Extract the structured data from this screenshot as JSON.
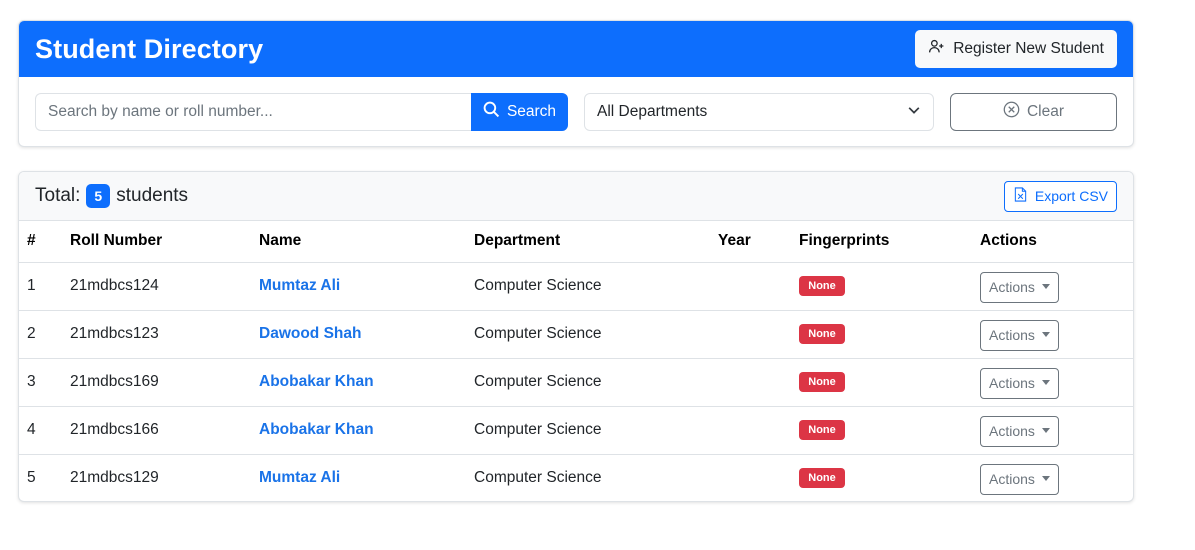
{
  "header": {
    "title": "Student Directory",
    "register_label": "Register New Student",
    "register_icon": "person-plus-icon"
  },
  "filters": {
    "search_placeholder": "Search by name or roll number...",
    "search_value": "",
    "search_label": "Search",
    "department_selected": "All Departments",
    "clear_label": "Clear"
  },
  "list": {
    "total_label": "Total:",
    "count": "5",
    "students_label": "students",
    "export_label": "Export CSV",
    "columns": [
      "#",
      "Roll Number",
      "Name",
      "Department",
      "Year",
      "Fingerprints",
      "Actions"
    ],
    "rows": [
      {
        "idx": "1",
        "roll": "21mdbcs124",
        "name": "Mumtaz Ali",
        "dept": "Computer Science",
        "year": "",
        "fingerprints": "None",
        "actions": "Actions"
      },
      {
        "idx": "2",
        "roll": "21mdbcs123",
        "name": "Dawood Shah",
        "dept": "Computer Science",
        "year": "",
        "fingerprints": "None",
        "actions": "Actions"
      },
      {
        "idx": "3",
        "roll": "21mdbcs169",
        "name": "Abobakar Khan",
        "dept": "Computer Science",
        "year": "",
        "fingerprints": "None",
        "actions": "Actions"
      },
      {
        "idx": "4",
        "roll": "21mdbcs166",
        "name": "Abobakar Khan",
        "dept": "Computer Science",
        "year": "",
        "fingerprints": "None",
        "actions": "Actions"
      },
      {
        "idx": "5",
        "roll": "21mdbcs129",
        "name": "Mumtaz Ali",
        "dept": "Computer Science",
        "year": "",
        "fingerprints": "None",
        "actions": "Actions"
      }
    ]
  },
  "colors": {
    "primary": "#0d6efd",
    "danger": "#dc3545",
    "link": "#1a73e8",
    "secondary": "#6c757d"
  }
}
